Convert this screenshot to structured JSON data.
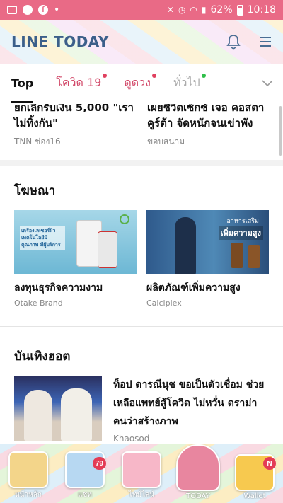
{
  "status_bar": {
    "battery": "62%",
    "time": "10:18"
  },
  "header": {
    "logo": "LINE TODAY"
  },
  "tabs": [
    {
      "label": "Top",
      "active": true
    },
    {
      "label": "โควิด 19",
      "dot": "#e0405f"
    },
    {
      "label": "ดูดวง",
      "dot": "#e0405f"
    },
    {
      "label": "ทั่วไป",
      "dot": "#2fbf4a"
    }
  ],
  "top_articles": [
    {
      "title": "ยกเลิกรับเงิน 5,000 \"เรา ไม่ทิ้งกัน\"",
      "source": "TNN ช่อง16"
    },
    {
      "title": "เผยชีวิตเซ็กซ์ เจอ คอสตา คูร์ต้า จัดหนักจนเข่าพัง",
      "source": "ขอบสนาม"
    }
  ],
  "ads_section": {
    "title": "โฆษณา",
    "items": [
      {
        "title": "ลงทุนธุรกิจความงาม",
        "source": "Otake Brand",
        "image_text": "เครื่องเลเซอร์ผิว เทคโนโลยีมีคุณภาพ มีผู้บริการ"
      },
      {
        "title": "ผลิตภัณฑ์เพิ่มความสูง",
        "source": "Calciplex",
        "image_text_1": "อาหารเสริม",
        "image_text_2": "เพิ่มความสูง"
      }
    ]
  },
  "entertainment_section": {
    "title": "บันเทิงฮอต",
    "items": [
      {
        "title": "ท็อป ดารณีนุช ขอเป็นตัวเชื่อม ช่วยเหลือแพทย์สู้โควิด ไม่หวั่น ดราม่าคนว่าสร้างภาพ",
        "source": "Khaosod"
      }
    ]
  },
  "bottom_nav": [
    {
      "label": "หน้าหลัก",
      "color": "#f3d58a"
    },
    {
      "label": "แชท",
      "color": "#b7d8f2",
      "badge": "79"
    },
    {
      "label": "ไทม์ไลน์",
      "color": "#f7b7c8"
    },
    {
      "label": "TODAY",
      "color": "#e8869f",
      "active": true
    },
    {
      "label": "Wallet",
      "color": "#f7c94f",
      "badge": "N"
    }
  ]
}
